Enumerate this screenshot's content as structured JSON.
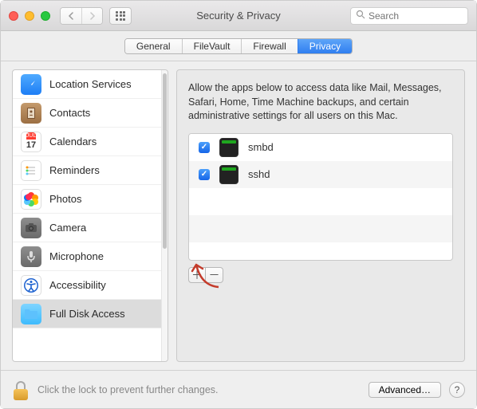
{
  "window": {
    "title": "Security & Privacy"
  },
  "search": {
    "placeholder": "Search"
  },
  "tabs": [
    {
      "label": "General"
    },
    {
      "label": "FileVault"
    },
    {
      "label": "Firewall"
    },
    {
      "label": "Privacy"
    }
  ],
  "sidebar": {
    "items": [
      {
        "label": "Location Services"
      },
      {
        "label": "Contacts"
      },
      {
        "label": "Calendars",
        "day": "17",
        "month": "JUL"
      },
      {
        "label": "Reminders"
      },
      {
        "label": "Photos"
      },
      {
        "label": "Camera"
      },
      {
        "label": "Microphone"
      },
      {
        "label": "Accessibility"
      },
      {
        "label": "Full Disk Access"
      }
    ]
  },
  "pane": {
    "description": "Allow the apps below to access data like Mail, Messages, Safari, Home, Time Machine backups, and certain administrative settings for all users on this Mac.",
    "apps": [
      {
        "name": "smbd",
        "checked": true
      },
      {
        "name": "sshd",
        "checked": true
      }
    ]
  },
  "footer": {
    "lock_text": "Click the lock to prevent further changes.",
    "advanced": "Advanced…"
  }
}
